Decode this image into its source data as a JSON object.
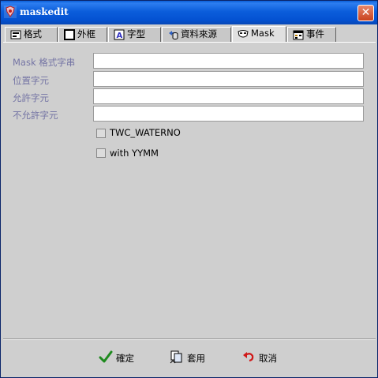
{
  "window": {
    "title": "maskedit",
    "close_glyph": "✕"
  },
  "tabs": [
    {
      "label": "格式",
      "icon": "format-icon"
    },
    {
      "label": "外框",
      "icon": "border-icon"
    },
    {
      "label": "字型",
      "icon": "font-icon"
    },
    {
      "label": "資料來源",
      "icon": "datasource-icon"
    },
    {
      "label": "Mask",
      "icon": "mask-icon",
      "active": true
    },
    {
      "label": "事件",
      "icon": "event-icon"
    }
  ],
  "fields": [
    {
      "label": "Mask 格式字串",
      "value": ""
    },
    {
      "label": "位置字元",
      "value": ""
    },
    {
      "label": "允許字元",
      "value": ""
    },
    {
      "label": "不允許字元",
      "value": ""
    }
  ],
  "checkboxes": [
    {
      "label": "TWC_WATERNO",
      "checked": false
    },
    {
      "label": "with YYMM",
      "checked": false
    }
  ],
  "buttons": {
    "ok": "確定",
    "apply": "套用",
    "cancel": "取消"
  },
  "colors": {
    "titlebar": "#0b5ddb",
    "label_text": "#7474a4",
    "panel_bg": "#cfcfcf"
  }
}
